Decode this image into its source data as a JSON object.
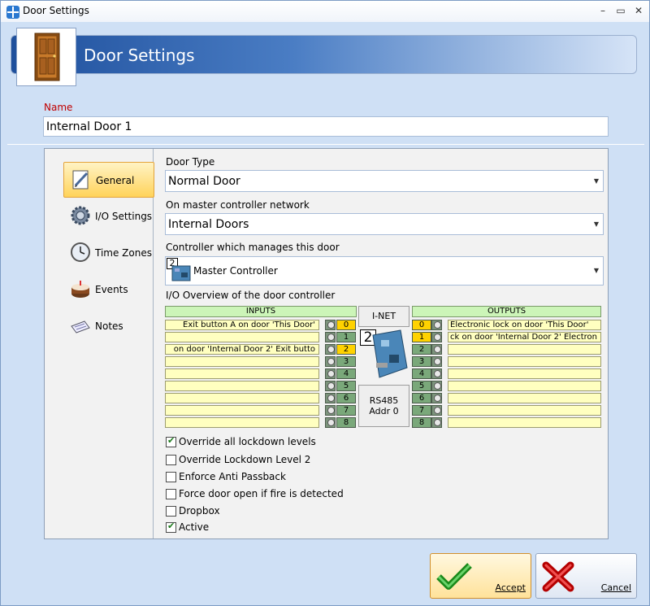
{
  "window": {
    "title": "Door Settings"
  },
  "header": {
    "title": "Door Settings"
  },
  "name": {
    "label": "Name",
    "value": "Internal Door 1"
  },
  "nav": {
    "items": [
      {
        "label": "General",
        "icon": "pencil-icon",
        "active": true
      },
      {
        "label": "I/O Settings",
        "icon": "gear-icon"
      },
      {
        "label": "Time Zones",
        "icon": "clock-icon"
      },
      {
        "label": "Events",
        "icon": "cake-icon"
      },
      {
        "label": "Notes",
        "icon": "notes-icon"
      }
    ]
  },
  "general": {
    "door_type_label": "Door Type",
    "door_type_value": "Normal Door",
    "network_label": "On master controller network",
    "network_value": "Internal Doors",
    "controller_label": "Controller which manages this door",
    "controller_badge": "2",
    "controller_value": "Master Controller",
    "io_overview_label": "I/O Overview of the door controller"
  },
  "io": {
    "inputs_header": "INPUTS",
    "outputs_header": "OUTPUTS",
    "inet_label": "I-NET",
    "controller_badge": "2",
    "rs485_label": "RS485",
    "addr_label": "Addr 0",
    "inputs": [
      {
        "num": "0",
        "text": "Exit button A on door 'This Door'",
        "active": true
      },
      {
        "num": "1",
        "text": "",
        "active": false
      },
      {
        "num": "2",
        "text": "on door 'Internal Door 2'  Exit butto",
        "active": true
      },
      {
        "num": "3",
        "text": "",
        "active": false
      },
      {
        "num": "4",
        "text": "",
        "active": false
      },
      {
        "num": "5",
        "text": "",
        "active": false
      },
      {
        "num": "6",
        "text": "",
        "active": false
      },
      {
        "num": "7",
        "text": "",
        "active": false
      },
      {
        "num": "8",
        "text": "",
        "active": false
      }
    ],
    "outputs": [
      {
        "num": "0",
        "text": "Electronic lock on door 'This Door'",
        "active": true
      },
      {
        "num": "1",
        "text": "ck on door 'Internal Door 2'  Electron",
        "active": true
      },
      {
        "num": "2",
        "text": "",
        "active": false
      },
      {
        "num": "3",
        "text": "",
        "active": false
      },
      {
        "num": "4",
        "text": "",
        "active": false
      },
      {
        "num": "5",
        "text": "",
        "active": false
      },
      {
        "num": "6",
        "text": "",
        "active": false
      },
      {
        "num": "7",
        "text": "",
        "active": false
      },
      {
        "num": "8",
        "text": "",
        "active": false
      }
    ]
  },
  "options": [
    {
      "label": "Override all lockdown levels",
      "checked": true
    },
    {
      "label": "Override Lockdown Level 2",
      "checked": false
    },
    {
      "label": "Enforce Anti Passback",
      "checked": false
    },
    {
      "label": "Force door open if fire is detected",
      "checked": false
    },
    {
      "label": "Dropbox",
      "checked": false
    },
    {
      "label": "Active",
      "checked": true
    }
  ],
  "buttons": {
    "accept": "Accept",
    "cancel": "Cancel"
  },
  "colors": {
    "accent": "#1e4f9c",
    "active_tab": "#ffd35a",
    "label_red": "#c00000"
  }
}
